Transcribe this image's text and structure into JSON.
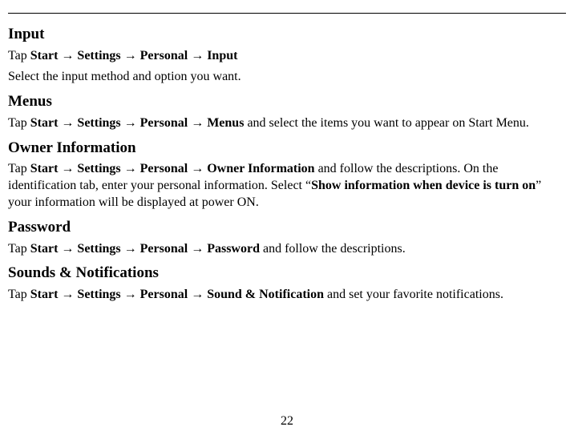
{
  "arrow": "→",
  "quote_open": "“",
  "quote_close": "”",
  "page_number": "22",
  "sections": {
    "input": {
      "heading": "Input",
      "path_prefix": "Tap ",
      "path_parts": [
        "Start",
        "Settings",
        "Personal",
        "Input"
      ],
      "body": "Select the input method and option you want."
    },
    "menus": {
      "heading": "Menus",
      "path_prefix": "Tap ",
      "path_parts": [
        "Start",
        "Settings",
        "Personal",
        "Menus"
      ],
      "suffix": " and select the items you want to appear on Start Menu."
    },
    "owner_info": {
      "heading": "Owner Information",
      "path_prefix": "Tap ",
      "path_parts": [
        "Start",
        "Settings",
        "Personal",
        "Owner Information"
      ],
      "mid1": " and follow the descriptions. On the identification tab, enter your personal information. Select ",
      "bold_option": "Show information when device is turn on",
      "mid2": " your information will be displayed at power ON."
    },
    "password": {
      "heading": "Password",
      "path_prefix": "Tap ",
      "path_parts": [
        "Start",
        "Settings",
        "Personal",
        "Password"
      ],
      "suffix": " and follow the descriptions."
    },
    "sounds": {
      "heading": "Sounds & Notifications",
      "path_prefix": "Tap ",
      "path_parts": [
        "Start",
        "Settings",
        "Personal",
        "Sound & Notification"
      ],
      "suffix": " and set your favorite notifications."
    }
  }
}
